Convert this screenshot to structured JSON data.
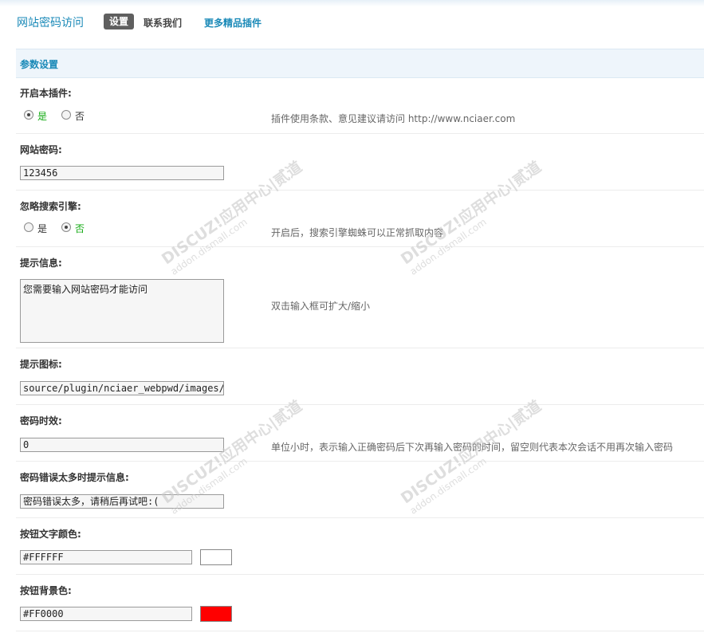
{
  "nav": {
    "title": "网站密码访问",
    "active_tab": "设置",
    "contact": "联系我们",
    "more": "更多精品插件"
  },
  "section": {
    "title": "参数设置"
  },
  "fields": {
    "enable": {
      "label": "开启本插件:",
      "options": [
        "是",
        "否"
      ],
      "selected": "是",
      "hint": "插件使用条款、意见建议请访问 http://www.nciaer.com"
    },
    "password": {
      "label": "网站密码:",
      "value": "123456"
    },
    "ignore_search": {
      "label": "忽略搜索引擎:",
      "options": [
        "是",
        "否"
      ],
      "selected": "否",
      "hint": "开启后，搜索引擎蜘蛛可以正常抓取内容"
    },
    "tip_message": {
      "label": "提示信息:",
      "value": "您需要输入网站密码才能访问",
      "hint": "双击输入框可扩大/缩小"
    },
    "tip_icon": {
      "label": "提示图标:",
      "value": "source/plugin/nciaer_webpwd/images/de"
    },
    "password_ttl": {
      "label": "密码时效:",
      "value": "0",
      "hint": "单位小时，表示输入正确密码后下次再输入密码的时间，留空则代表本次会话不用再次输入密码"
    },
    "error_message": {
      "label": "密码错误太多时提示信息:",
      "value": "密码错误太多，请稍后再试吧:("
    },
    "button_text_color": {
      "label": "按钮文字颜色:",
      "value": "#FFFFFF",
      "swatch": "#FFFFFF"
    },
    "button_bg_color": {
      "label": "按钮背景色:",
      "value": "#FF0000",
      "swatch": "#FF0000"
    }
  },
  "watermark": {
    "brand": "DISCUZ!应用中心|贰道",
    "domain": "addon.dismall.com"
  },
  "colors": {
    "accent": "#1b8ab8",
    "checked_option": "#11aa11",
    "active_tab_bg": "#5f5f5f"
  }
}
